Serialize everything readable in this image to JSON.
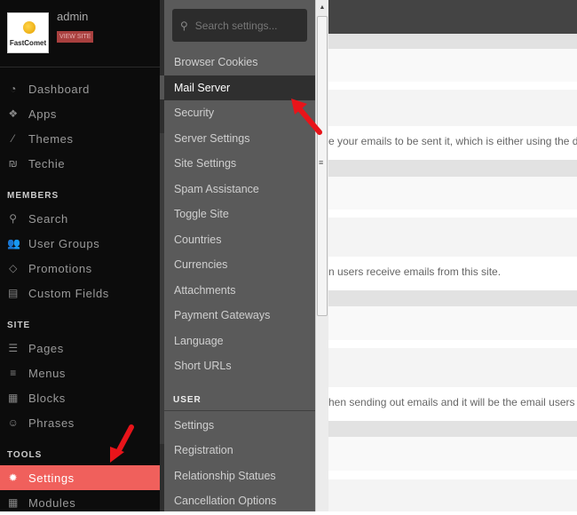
{
  "profile": {
    "logo_text": "FastComet",
    "username": "admin",
    "view_site": "VIEW SITE"
  },
  "sidebar": {
    "items": [
      {
        "label": "Dashboard",
        "icon": "dashboard-icon",
        "glyph": "◔"
      },
      {
        "label": "Apps",
        "icon": "apps-icon",
        "glyph": "❖"
      },
      {
        "label": "Themes",
        "icon": "brush-icon",
        "glyph": "⁄"
      },
      {
        "label": "Techie",
        "icon": "techie-icon",
        "glyph": "₪"
      }
    ],
    "members_title": "MEMBERS",
    "members": [
      {
        "label": "Search",
        "icon": "search-icon",
        "glyph": "⚲"
      },
      {
        "label": "User Groups",
        "icon": "users-icon",
        "glyph": "👥"
      },
      {
        "label": "Promotions",
        "icon": "diamond-icon",
        "glyph": "◇"
      },
      {
        "label": "Custom Fields",
        "icon": "fields-icon",
        "glyph": "▤"
      }
    ],
    "site_title": "SITE",
    "site": [
      {
        "label": "Pages",
        "icon": "pages-icon",
        "glyph": "☰"
      },
      {
        "label": "Menus",
        "icon": "menu-icon",
        "glyph": "≡"
      },
      {
        "label": "Blocks",
        "icon": "blocks-icon",
        "glyph": "▦"
      },
      {
        "label": "Phrases",
        "icon": "phrases-icon",
        "glyph": "☺"
      }
    ],
    "tools_title": "TOOLS",
    "tools": [
      {
        "label": "Settings",
        "icon": "gear-icon",
        "glyph": "✹",
        "active": true
      },
      {
        "label": "Modules",
        "icon": "modules-icon",
        "glyph": "▦"
      }
    ]
  },
  "settings_panel": {
    "search_placeholder": "Search settings...",
    "items": [
      "Browser Cookies",
      "Mail Server",
      "Security",
      "Server Settings",
      "Site Settings",
      "Spam Assistance",
      "Toggle Site",
      "Countries",
      "Currencies",
      "Attachments",
      "Payment Gateways",
      "Language",
      "Short URLs"
    ],
    "active": "Mail Server",
    "user_title": "USER",
    "user_items": [
      "Settings",
      "Registration",
      "Relationship Statues",
      "Cancellation Options"
    ]
  },
  "main": {
    "texts": [
      "e your emails to be sent it, which is either using the default",
      "n users receive emails from this site.",
      "hen sending out emails and it will be the email users will"
    ]
  },
  "colors": {
    "accent": "#f0605c",
    "arrow": "#e8141a"
  }
}
